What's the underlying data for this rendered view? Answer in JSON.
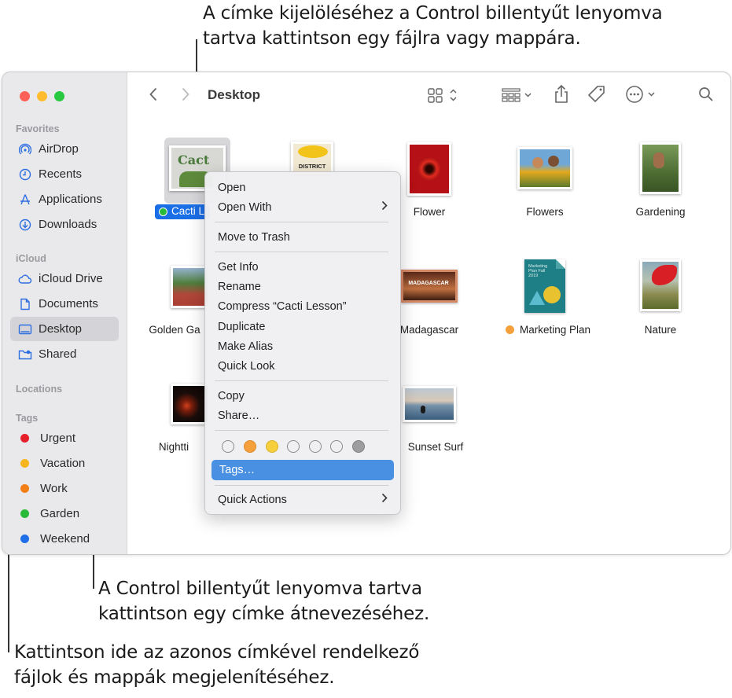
{
  "callouts": {
    "top_line1": "A címke kijelöléséhez a Control billentyűt lenyomva",
    "top_line2": "tartva kattintson egy fájlra vagy mappára.",
    "mid_line1": "A Control billentyűt lenyomva tartva",
    "mid_line2": "kattintson egy címke átnevezéséhez.",
    "bot_line1": "Kattintson ide az azonos címkével rendelkező",
    "bot_line2": "fájlok és mappák megjelenítéséhez."
  },
  "window": {
    "title": "Desktop"
  },
  "sidebar": {
    "favorites_label": "Favorites",
    "favorites": [
      {
        "label": "AirDrop",
        "icon": "airdrop-icon"
      },
      {
        "label": "Recents",
        "icon": "clock-icon"
      },
      {
        "label": "Applications",
        "icon": "applications-icon"
      },
      {
        "label": "Downloads",
        "icon": "download-icon"
      }
    ],
    "icloud_label": "iCloud",
    "icloud": [
      {
        "label": "iCloud Drive",
        "icon": "cloud-icon"
      },
      {
        "label": "Documents",
        "icon": "document-icon"
      },
      {
        "label": "Desktop",
        "icon": "desktop-icon",
        "selected": true
      },
      {
        "label": "Shared",
        "icon": "shared-folder-icon"
      }
    ],
    "locations_label": "Locations",
    "tags_label": "Tags",
    "tags": [
      {
        "label": "Urgent",
        "color": "#e5202a"
      },
      {
        "label": "Vacation",
        "color": "#f6b51c"
      },
      {
        "label": "Work",
        "color": "#f57f17"
      },
      {
        "label": "Garden",
        "color": "#2aba3a"
      },
      {
        "label": "Weekend",
        "color": "#1f6fe8"
      }
    ]
  },
  "files": {
    "cacti": "Cacti L",
    "flower": "Flower",
    "flowers": "Flowers",
    "gardening": "Gardening",
    "golden": "Golden Ga",
    "madagascar": "Madagascar",
    "marketing": "Marketing Plan",
    "nature": "Nature",
    "nightti": "Nightti",
    "sunset": "Sunset Surf",
    "cacti_thumb_text": "Cact",
    "district_thumb_text": "DISTRICT",
    "marketing_thumb_text": "Marketing Plan Fall 2019",
    "madagascar_thumb_text": "MADAGASCAR"
  },
  "menu": {
    "open": "Open",
    "open_with": "Open With",
    "move_to_trash": "Move to Trash",
    "get_info": "Get Info",
    "rename": "Rename",
    "compress": "Compress “Cacti Lesson”",
    "duplicate": "Duplicate",
    "make_alias": "Make Alias",
    "quick_look": "Quick Look",
    "copy": "Copy",
    "share": "Share…",
    "tags": "Tags…",
    "quick_actions": "Quick Actions",
    "tag_colors": [
      "none",
      "#f5a03a",
      "#f7cf3c",
      "none",
      "none",
      "none",
      "#9d9d9f"
    ]
  },
  "colors": {
    "accent": "#2e6fe0",
    "selection": "#1a6ee6"
  }
}
